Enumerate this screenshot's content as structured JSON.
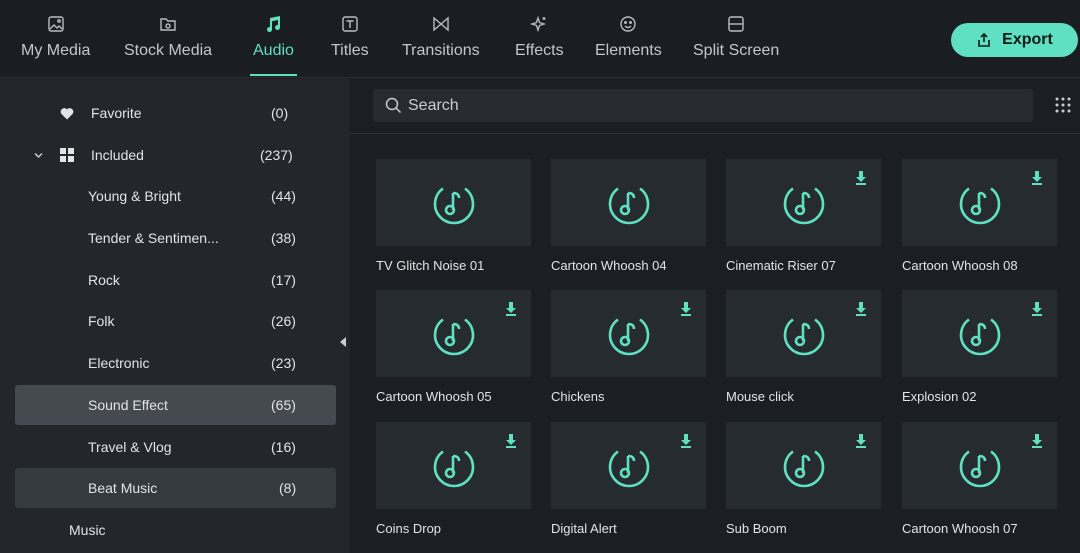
{
  "toolbar": {
    "tabs": [
      {
        "label": "My Media",
        "icon": "image-icon"
      },
      {
        "label": "Stock Media",
        "icon": "folder-icon"
      },
      {
        "label": "Audio",
        "icon": "music-note-icon",
        "active": true
      },
      {
        "label": "Titles",
        "icon": "text-icon"
      },
      {
        "label": "Transitions",
        "icon": "transition-icon"
      },
      {
        "label": "Effects",
        "icon": "sparkle-icon"
      },
      {
        "label": "Elements",
        "icon": "sticker-icon"
      },
      {
        "label": "Split Screen",
        "icon": "split-screen-icon"
      }
    ],
    "export_label": "Export"
  },
  "sidebar": {
    "items": [
      {
        "label": "Favorite",
        "count": "(0)"
      },
      {
        "label": "Included",
        "count": "(237)"
      },
      {
        "label": "Young & Bright",
        "count": "(44)"
      },
      {
        "label": "Tender & Sentimen...",
        "count": "(38)"
      },
      {
        "label": "Rock",
        "count": "(17)"
      },
      {
        "label": "Folk",
        "count": "(26)"
      },
      {
        "label": "Electronic",
        "count": "(23)"
      },
      {
        "label": "Sound Effect",
        "count": "(65)"
      },
      {
        "label": "Travel & Vlog",
        "count": "(16)"
      },
      {
        "label": "Beat Music",
        "count": "(8)"
      },
      {
        "label": "Music",
        "count": ""
      }
    ]
  },
  "search": {
    "placeholder": "Search"
  },
  "cards": [
    {
      "title": "TV Glitch Noise 01",
      "downloadable": false
    },
    {
      "title": "Cartoon Whoosh 04",
      "downloadable": false
    },
    {
      "title": "Cinematic Riser 07",
      "downloadable": true
    },
    {
      "title": "Cartoon Whoosh 08",
      "downloadable": true
    },
    {
      "title": "Cartoon Whoosh 05",
      "downloadable": true
    },
    {
      "title": "Chickens",
      "downloadable": true
    },
    {
      "title": "Mouse click",
      "downloadable": true
    },
    {
      "title": "Explosion 02",
      "downloadable": true
    },
    {
      "title": "Coins Drop",
      "downloadable": true
    },
    {
      "title": "Digital Alert",
      "downloadable": true
    },
    {
      "title": "Sub Boom",
      "downloadable": true
    },
    {
      "title": "Cartoon Whoosh 07",
      "downloadable": true
    }
  ],
  "colors": {
    "accent": "#5fe0c2",
    "background": "#1b1f23",
    "sidebar": "#23272c"
  }
}
